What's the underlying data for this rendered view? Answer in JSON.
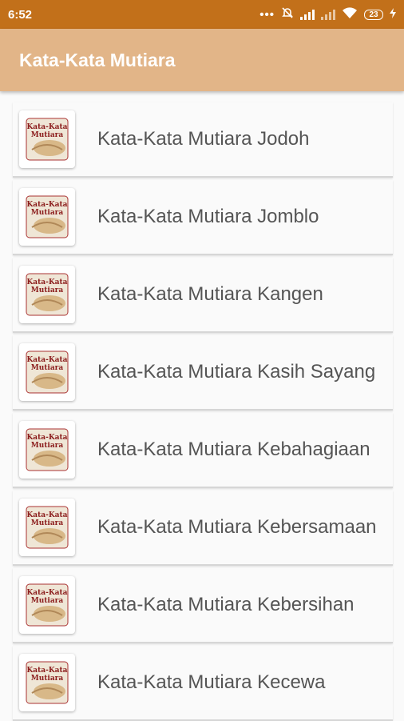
{
  "status": {
    "time": "6:52",
    "battery": "23"
  },
  "app": {
    "title": "Kata-Kata Mutiara"
  },
  "thumb": {
    "line1": "Kata-Kata",
    "line2": "Mutiara"
  },
  "items": [
    {
      "label": "Kata-Kata Mutiara Jodoh"
    },
    {
      "label": "Kata-Kata Mutiara Jomblo"
    },
    {
      "label": "Kata-Kata Mutiara Kangen"
    },
    {
      "label": "Kata-Kata Mutiara Kasih Sayang"
    },
    {
      "label": "Kata-Kata Mutiara Kebahagiaan"
    },
    {
      "label": "Kata-Kata Mutiara Kebersamaan"
    },
    {
      "label": "Kata-Kata Mutiara Kebersihan"
    },
    {
      "label": "Kata-Kata Mutiara Kecewa"
    }
  ]
}
